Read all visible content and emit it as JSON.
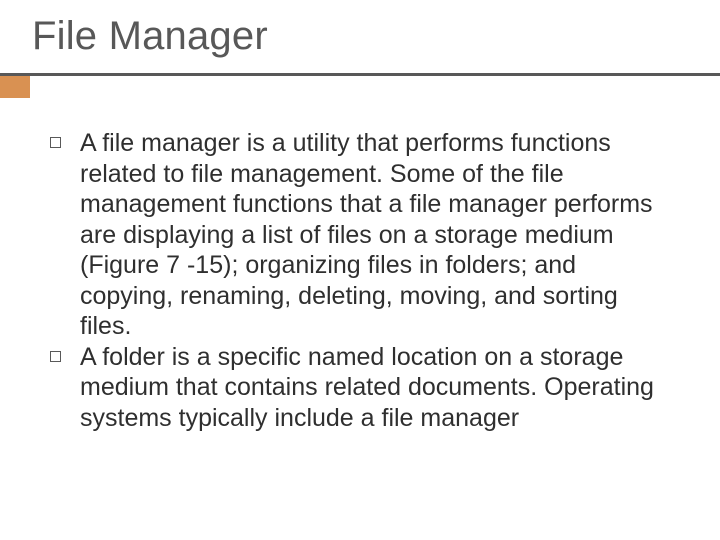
{
  "title": "File Manager",
  "bullets": [
    "A file manager is a utility that performs functions related to file management. Some of the file management functions that a file manager performs are displaying a list of files on a storage medium (Figure 7 -15); organizing files in folders; and copying, renaming, deleting, moving, and sorting files.",
    "A folder is a specific named location on a storage medium that contains related documents. Operating systems typically include a file manager"
  ]
}
